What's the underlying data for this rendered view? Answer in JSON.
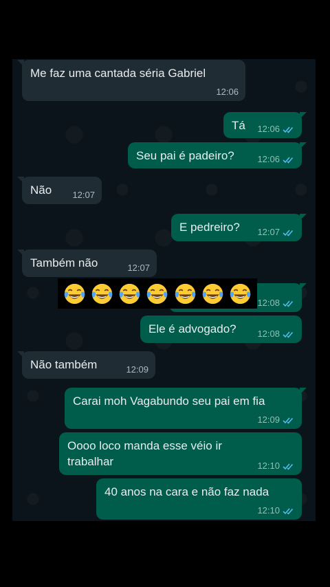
{
  "messages": [
    {
      "id": "m1",
      "dir": "in",
      "text": "Me faz uma cantada séria Gabriel",
      "time": "12:06"
    },
    {
      "id": "m2",
      "dir": "out",
      "text": "Tá",
      "time": "12:06",
      "status": "read"
    },
    {
      "id": "m3",
      "dir": "out",
      "text": "Seu pai é padeiro?",
      "time": "12:06",
      "status": "read"
    },
    {
      "id": "m4",
      "dir": "in",
      "text": "Não",
      "time": "12:07"
    },
    {
      "id": "m5",
      "dir": "out",
      "text": "E pedreiro?",
      "time": "12:07",
      "status": "read"
    },
    {
      "id": "m6",
      "dir": "in",
      "text": "Também não",
      "time": "12:07"
    },
    {
      "id": "m7",
      "dir": "out",
      "text": "",
      "time": "12:08",
      "status": "read"
    },
    {
      "id": "m8",
      "dir": "out",
      "text": "Ele é advogado?",
      "time": "12:08",
      "status": "read"
    },
    {
      "id": "m9",
      "dir": "in",
      "text": "Não também",
      "time": "12:09"
    },
    {
      "id": "m10",
      "dir": "out",
      "text": "Carai moh Vagabundo seu pai em fia",
      "time": "12:09",
      "status": "read"
    },
    {
      "id": "m11",
      "dir": "out",
      "text": "Oooo loco manda esse véio ir\ntrabalhar",
      "time": "12:10",
      "status": "read"
    },
    {
      "id": "m12",
      "dir": "out",
      "text": "40 anos na cara e não faz nada",
      "time": "12:10",
      "status": "read"
    }
  ],
  "overlay": {
    "emoji": "face-with-tears-of-joy",
    "count": 7
  },
  "colors": {
    "chat_bg": "#0b141a",
    "incoming": "#202c33",
    "outgoing": "#005c4b",
    "read_tick": "#53bdeb"
  }
}
